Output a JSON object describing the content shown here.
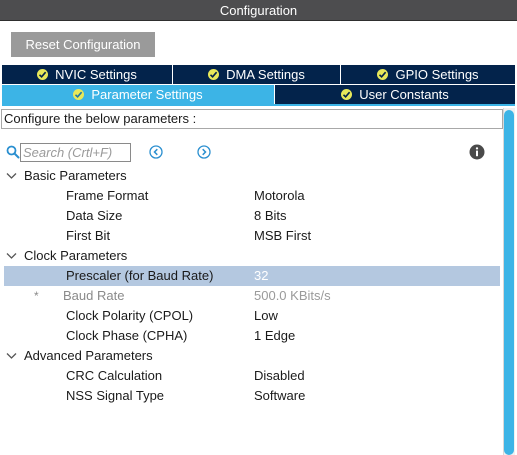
{
  "window": {
    "title": "Configuration"
  },
  "toolbar": {
    "reset_label": "Reset Configuration"
  },
  "tabs": {
    "row1": [
      {
        "label": "NVIC Settings",
        "icon": "check-circle-icon"
      },
      {
        "label": "DMA Settings",
        "icon": "check-circle-icon"
      },
      {
        "label": "GPIO Settings",
        "icon": "check-circle-icon"
      }
    ],
    "row2": [
      {
        "label": "Parameter Settings",
        "icon": "check-circle-icon",
        "active": true
      },
      {
        "label": "User Constants",
        "icon": "check-circle-icon"
      }
    ]
  },
  "description": "Configure the below parameters :",
  "search": {
    "placeholder": "Search (Crtl+F)",
    "value": ""
  },
  "colors": {
    "tab_dark": "#03234b",
    "tab_active": "#3cb4e6",
    "check": "#e8e85a",
    "selected_row": "#b4c8e0",
    "titlebar": "#4d4d4f"
  },
  "groups": [
    {
      "label": "Basic Parameters",
      "params": [
        {
          "name": "Frame Format",
          "value": "Motorola"
        },
        {
          "name": "Data Size",
          "value": "8 Bits"
        },
        {
          "name": "First Bit",
          "value": "MSB First"
        }
      ]
    },
    {
      "label": "Clock Parameters",
      "params": [
        {
          "name": "Prescaler (for Baud Rate)",
          "value": "32",
          "selected": true
        },
        {
          "name": "Baud Rate",
          "value": "500.0 KBits/s",
          "readonly": true,
          "marker": "*"
        },
        {
          "name": "Clock Polarity (CPOL)",
          "value": "Low"
        },
        {
          "name": "Clock Phase (CPHA)",
          "value": "1 Edge"
        }
      ]
    },
    {
      "label": "Advanced Parameters",
      "params": [
        {
          "name": "CRC Calculation",
          "value": "Disabled"
        },
        {
          "name": "NSS Signal Type",
          "value": "Software"
        }
      ]
    }
  ]
}
